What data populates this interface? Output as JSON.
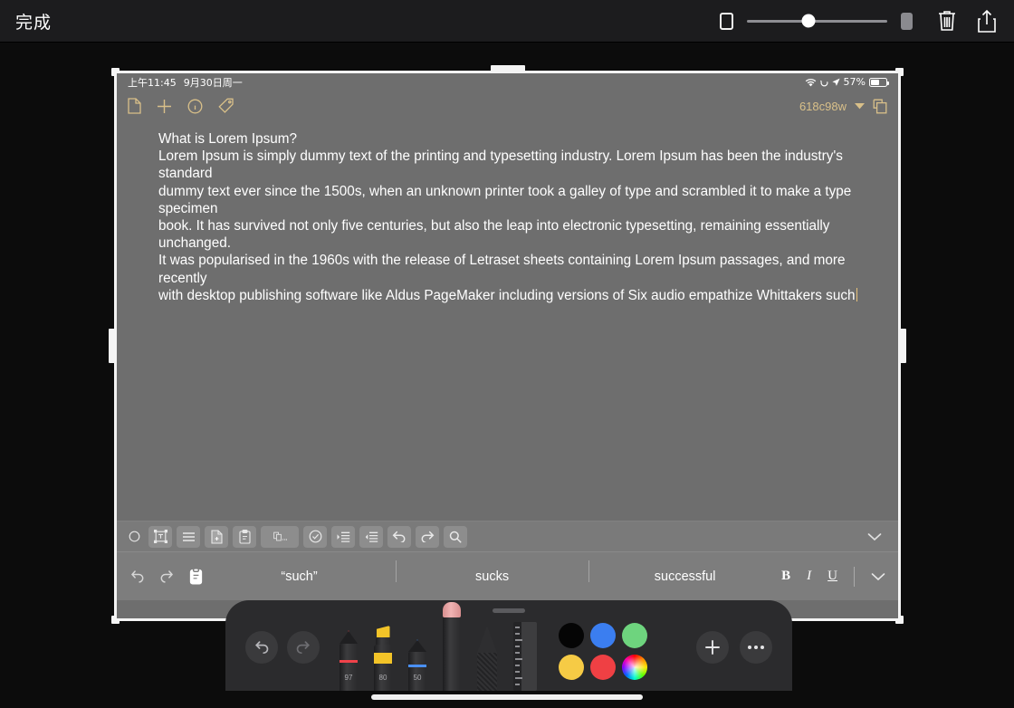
{
  "chrome": {
    "done_label": "完成",
    "slider_value_percent": 44,
    "icons": {
      "square_outline": "square-outline-icon",
      "square_filled": "square-filled-icon",
      "trash": "trash-icon",
      "share": "share-icon"
    }
  },
  "device": {
    "status_bar": {
      "time": "上午11:45",
      "date": "9月30日周一",
      "wifi_icon": "wifi-icon",
      "rotation_lock_icon": "rotation-lock-icon",
      "location_icon": "location-arrow-icon",
      "battery_percent_label": "57%",
      "battery_level": 57
    },
    "app_toolbar": {
      "left_icons": [
        {
          "name": "document-icon",
          "label": "Document"
        },
        {
          "name": "add-icon",
          "label": "Add"
        },
        {
          "name": "info-icon",
          "label": "Info"
        },
        {
          "name": "tag-icon",
          "label": "Tag"
        }
      ],
      "document_name": "618c98w",
      "dropdown_icon": "chevron-down-icon",
      "duplicate_icon": "duplicate-icon",
      "accent_color": "#d9c089"
    },
    "document": {
      "heading": "What is Lorem Ipsum?",
      "paragraph_lines": [
        "Lorem Ipsum is simply dummy text of the printing and typesetting industry. Lorem Ipsum has been the industry's standard",
        "dummy text ever since the 1500s, when an unknown printer took a galley of type and scrambled it to make a type specimen",
        "book. It has survived not only five centuries, but also the leap into electronic typesetting, remaining essentially unchanged.",
        "It was popularised in the 1960s with the release of Letraset sheets containing Lorem Ipsum passages, and more recently",
        "with desktop publishing software like Aldus PageMaker including versions of Six audio empathize Whittakers such"
      ]
    },
    "format_toolbar": {
      "buttons": [
        {
          "name": "record-circle-icon",
          "label": "Record"
        },
        {
          "name": "text-box-icon",
          "label": "Text box"
        },
        {
          "name": "list-lines-icon",
          "label": "Lines"
        },
        {
          "name": "new-document-icon",
          "label": "New document"
        },
        {
          "name": "clipboard-icon",
          "label": "Clipboard"
        },
        {
          "name": "copy-paste-more-icon",
          "label": "Copy / Paste…"
        },
        {
          "name": "checkbox-icon",
          "label": "Checklist"
        },
        {
          "name": "indent-increase-icon",
          "label": "Increase indent"
        },
        {
          "name": "indent-decrease-icon",
          "label": "Decrease indent"
        },
        {
          "name": "undo-icon",
          "label": "Undo"
        },
        {
          "name": "redo-icon",
          "label": "Redo"
        },
        {
          "name": "search-icon",
          "label": "Search"
        }
      ],
      "collapse_icon": "chevron-down-icon",
      "ellipsis_label": "..."
    },
    "suggestion_bar": {
      "left_icons": [
        {
          "name": "undo-icon",
          "label": "Undo"
        },
        {
          "name": "redo-icon",
          "label": "Redo"
        },
        {
          "name": "paste-icon",
          "label": "Paste"
        }
      ],
      "suggestions": [
        "“such”",
        "sucks",
        "successful"
      ],
      "right_controls": [
        {
          "name": "bold-button",
          "label": "B"
        },
        {
          "name": "italic-button",
          "label": "I"
        },
        {
          "name": "underline-button",
          "label": "U"
        }
      ],
      "dismiss_icon": "chevron-down-icon"
    },
    "pencil_palette": {
      "undo_icon": "undo-icon",
      "redo_icon": "redo-icon",
      "tools": [
        {
          "name": "pen-tool",
          "label": "Pen",
          "size": "97",
          "color": "#f0424a"
        },
        {
          "name": "highlighter-tool",
          "label": "Highlighter",
          "size": "80",
          "color": "#f3c428"
        },
        {
          "name": "marker-tool",
          "label": "Marker",
          "size": "50",
          "color": "#4a90f5"
        },
        {
          "name": "eraser-tool",
          "label": "Eraser",
          "size": "",
          "color": "#e3a0a0"
        },
        {
          "name": "pencil-tool",
          "label": "Pencil",
          "size": "",
          "color": "#3a3a3c"
        },
        {
          "name": "ruler-tool",
          "label": "Ruler",
          "size": "",
          "color": "#3d3d3f"
        }
      ],
      "colors": [
        {
          "name": "swatch-black",
          "hex": "#050505"
        },
        {
          "name": "swatch-blue",
          "hex": "#3b7ef0"
        },
        {
          "name": "swatch-green",
          "hex": "#6ed47e"
        },
        {
          "name": "swatch-yellow",
          "hex": "#f6cb45"
        },
        {
          "name": "swatch-red",
          "hex": "#ef4044"
        },
        {
          "name": "swatch-rainbow",
          "hex": "rainbow"
        }
      ],
      "add_icon": "plus-icon",
      "more_icon": "ellipsis-icon"
    }
  }
}
